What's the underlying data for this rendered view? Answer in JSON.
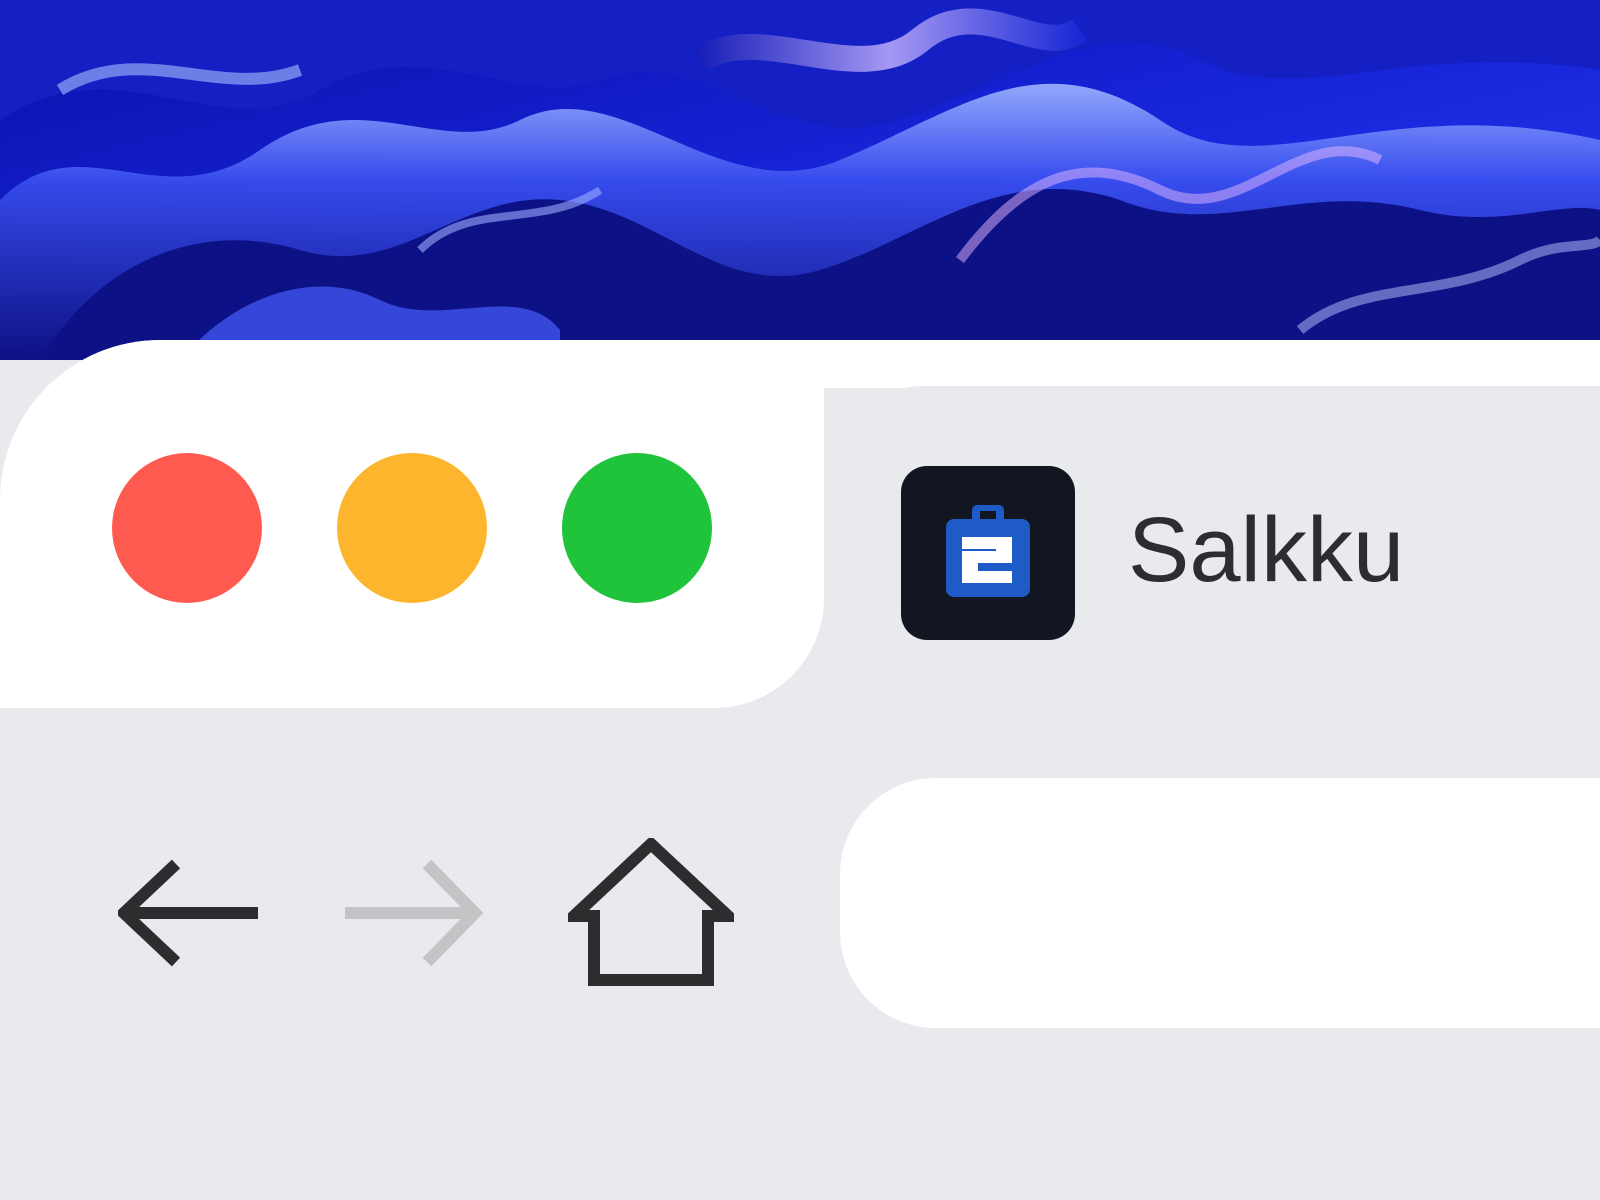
{
  "colors": {
    "close": "#ff5a4f",
    "minimize": "#fdb52d",
    "maximize": "#20c43b",
    "chrome_white": "#ffffff",
    "chrome_gray": "#e9eaee",
    "text": "#2d2d2f",
    "favicon_bg": "#121620",
    "favicon_accent": "#1f5bc7"
  },
  "window_controls": {
    "close_icon": "close-dot",
    "minimize_icon": "minimize-dot",
    "maximize_icon": "maximize-dot"
  },
  "tab": {
    "title": "Salkku",
    "favicon_icon": "briefcase-e-logo"
  },
  "toolbar": {
    "back_icon": "arrow-left",
    "forward_icon": "arrow-right",
    "forward_enabled": false,
    "home_icon": "home"
  },
  "address_bar": {
    "value": "",
    "placeholder": ""
  }
}
